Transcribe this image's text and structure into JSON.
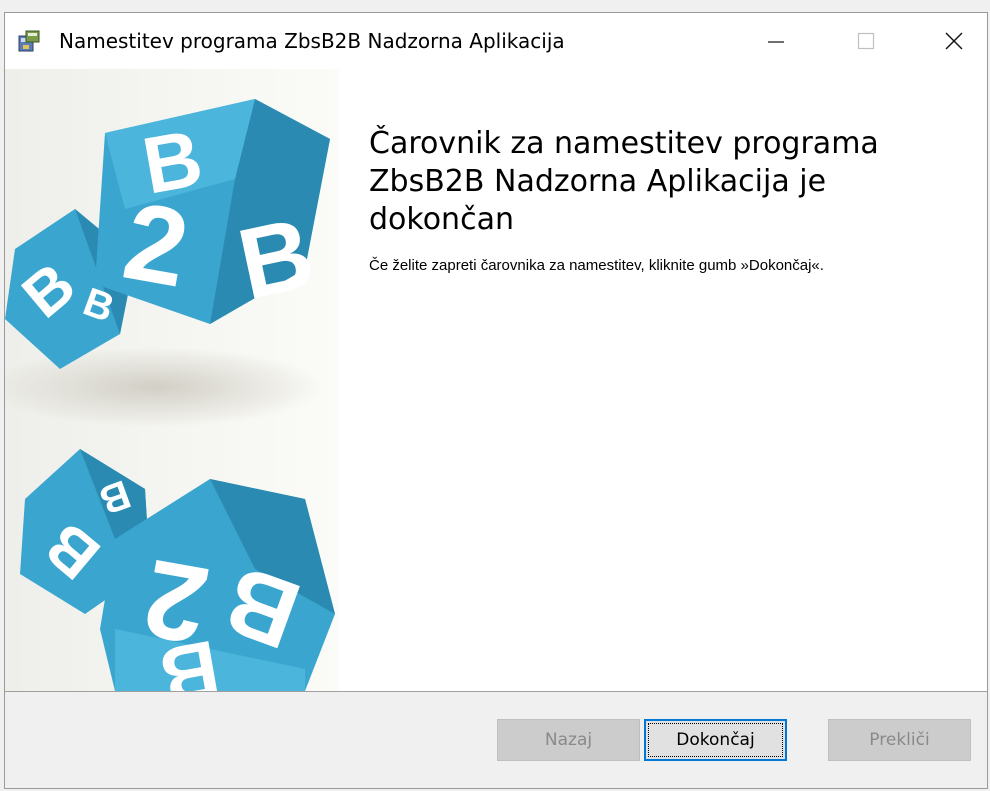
{
  "window": {
    "title": "Namestitev programa ZbsB2B Nadzorna Aplikacija",
    "controls": {
      "minimize": "—",
      "maximize": "☐",
      "close": "✕"
    }
  },
  "sidebar": {
    "image": "b2b-cubes-graphic",
    "colors": {
      "cube": "#3aa6cf",
      "cube_dark": "#2b8ab1",
      "letter": "#ffffff"
    }
  },
  "content": {
    "heading": "Čarovnik za namestitev programa ZbsB2B Nadzorna Aplikacija je dokončan",
    "description": "Če želite zapreti čarovnika za namestitev, kliknite gumb »Dokončaj«."
  },
  "buttons": {
    "back": "Nazaj",
    "finish": "Dokončaj",
    "cancel": "Prekliči"
  },
  "colors": {
    "accent": "#0078d7",
    "disabled_text": "#8a8a8a"
  }
}
